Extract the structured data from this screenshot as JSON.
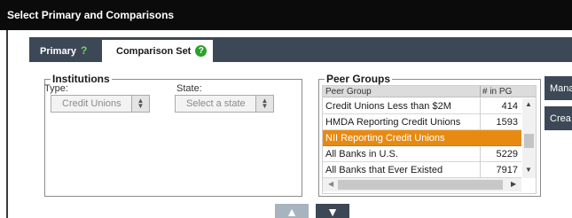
{
  "window": {
    "title": "Select Primary and Comparisons"
  },
  "tabs": [
    {
      "label": "Primary",
      "badge": "?"
    },
    {
      "label": "Comparison Set",
      "badge": "?"
    }
  ],
  "institutions": {
    "legend": "Institutions",
    "type_label": "Type:",
    "type_value": "Credit Unions",
    "state_label": "State:",
    "state_value": "Select a state"
  },
  "peer_groups": {
    "legend": "Peer Groups",
    "columns": [
      "Peer Group",
      "# in PG"
    ],
    "rows": [
      {
        "name": "Credit Unions Less than $2M",
        "count": "414"
      },
      {
        "name": "HMDA Reporting Credit Unions",
        "count": "1593"
      },
      {
        "name": "NII Reporting Credit Unions",
        "count": ""
      },
      {
        "name": "All Banks in U.S.",
        "count": "5229"
      },
      {
        "name": "All Banks that Ever Existed",
        "count": "7917"
      }
    ],
    "selected_index": 2
  },
  "side_buttons": {
    "manage_label": "Mana",
    "create_label": "Crea"
  },
  "icons": {
    "up_arrow": "▲",
    "down_arrow": "▼",
    "scroll_up": "▲",
    "scroll_down": "▼",
    "scroll_left": "◀",
    "scroll_right": "▶",
    "spinner_up": "▲",
    "spinner_down": "▼"
  },
  "colors": {
    "title_bar": "#0b0b0b",
    "tab_bar": "#3c4856",
    "selected_row": "#e88a12",
    "badge_green": "#2aa12a"
  }
}
